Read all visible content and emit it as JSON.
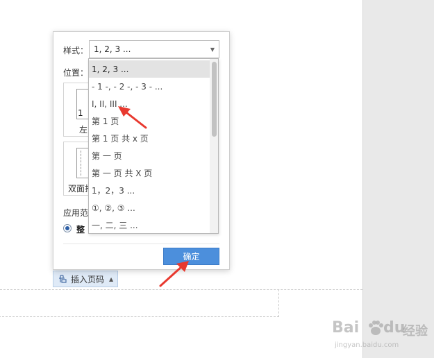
{
  "dialog": {
    "style_label": "样式：",
    "style_value": "1, 2, 3 ...",
    "position_label": "位置：",
    "position_box1_number": "1",
    "position_box1_caption": "左",
    "position_box2_caption": "双面打",
    "apply_label": "应用范",
    "apply_option": "整",
    "ok_label": "确定"
  },
  "dropdown": {
    "options": [
      "1, 2, 3 ...",
      "- 1 -, - 2 -, - 3 - ...",
      "I, II, III ...",
      "第 1 页",
      "第 1 页 共 x 页",
      "第 一 页",
      "第 一 页 共 X 页",
      "1，2，3 ...",
      "①, ②, ③ ...",
      "一, 二, 三 ..."
    ],
    "selected_index": 0
  },
  "toolbar": {
    "insert_page_number_label": "插入页码"
  },
  "watermark": {
    "brand_latin": "Bai",
    "brand_latin2": "du",
    "brand_cn": "经验",
    "url": "jingyan.baidu.com"
  },
  "colors": {
    "accent": "#4c8fdc",
    "annotation": "#e8392f",
    "tab_bg": "#dfeaf7"
  }
}
